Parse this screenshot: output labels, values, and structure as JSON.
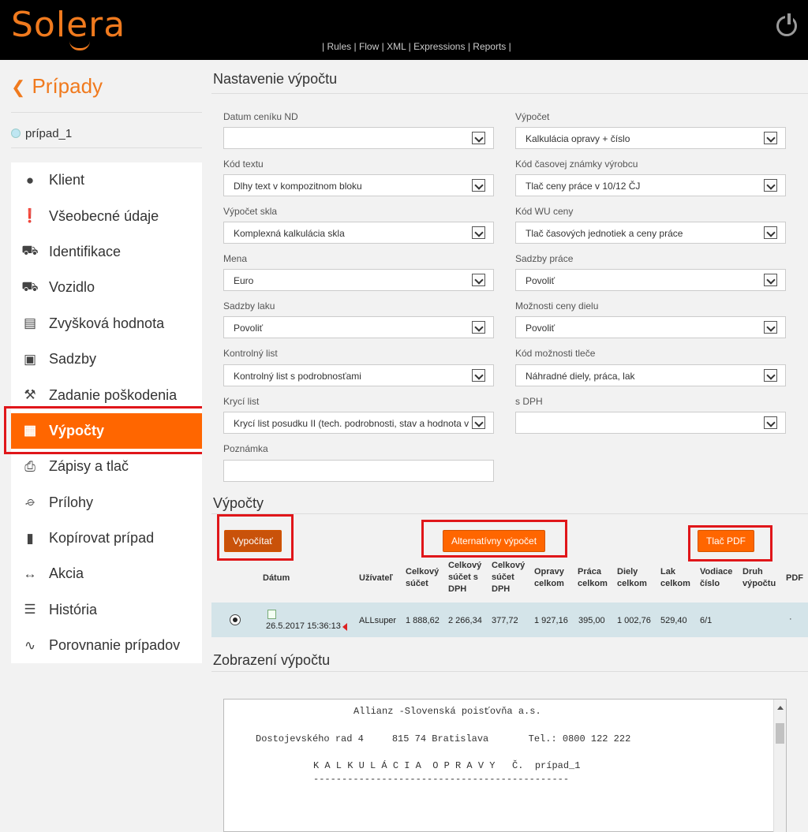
{
  "header": {
    "logo": "Solera",
    "nav": [
      "Rules",
      "Flow",
      "XML",
      "Expressions",
      "Reports"
    ]
  },
  "sidebar": {
    "back_label": "Prípady",
    "case_name": "prípad_1",
    "items": [
      {
        "label": "Klient",
        "icon": "user-icon"
      },
      {
        "label": "Všeobecné údaje",
        "icon": "exclamation-icon"
      },
      {
        "label": "Identifikace",
        "icon": "car-icon"
      },
      {
        "label": "Vozidlo",
        "icon": "taxi-icon"
      },
      {
        "label": "Zvyšková hodnota",
        "icon": "bar-chart-icon"
      },
      {
        "label": "Sadzby",
        "icon": "money-icon"
      },
      {
        "label": "Zadanie poškodenia",
        "icon": "wrench-icon"
      },
      {
        "label": "Výpočty",
        "icon": "calculator-icon",
        "active": true
      },
      {
        "label": "Zápisy a tlač",
        "icon": "printer-icon"
      },
      {
        "label": "Prílohy",
        "icon": "paperclip-icon"
      },
      {
        "label": "Kopírovat prípad",
        "icon": "book-icon"
      },
      {
        "label": "Akcia",
        "icon": "arrows-icon"
      },
      {
        "label": "História",
        "icon": "list-icon"
      },
      {
        "label": "Porovnanie prípadov",
        "icon": "line-chart-icon"
      }
    ]
  },
  "settings": {
    "title": "Nastavenie výpočtu",
    "left": [
      {
        "label": "Datum ceníku ND",
        "value": ""
      },
      {
        "label": "Kód textu",
        "value": "Dlhy text v kompozitnom bloku"
      },
      {
        "label": "Výpočet skla",
        "value": "Komplexná kalkulácia skla"
      },
      {
        "label": "Mena",
        "value": "Euro"
      },
      {
        "label": "Sadzby laku",
        "value": "Povoliť"
      },
      {
        "label": "Kontrolný list",
        "value": "Kontrolný list s podrobnosťami"
      },
      {
        "label": "Krycí list",
        "value": "Krycí list posudku II (tech. podrobnosti, stav a hodnota v"
      }
    ],
    "right": [
      {
        "label": "Výpočet",
        "value": "Kalkulácia opravy + číslo"
      },
      {
        "label": "Kód časovej známky výrobcu",
        "value": "Tlač ceny práce v 10/12 ČJ"
      },
      {
        "label": "Kód WU ceny",
        "value": "Tlač časových jednotiek a ceny práce"
      },
      {
        "label": "Sadzby práce",
        "value": "Povoliť"
      },
      {
        "label": "Možnosti ceny dielu",
        "value": "Povoliť"
      },
      {
        "label": "Kód možnosti tleče",
        "value": "Náhradné diely, práca, lak"
      },
      {
        "label": "s DPH",
        "value": ""
      }
    ],
    "note_label": "Poznámka"
  },
  "calculations": {
    "title": "Výpočty",
    "buttons": {
      "compute": "Vypočítať",
      "alternative": "Alternatívny výpočet",
      "print_pdf": "Tlač PDF"
    },
    "columns": [
      "Dátum",
      "Užívateľ",
      "Celkový súčet",
      "Celkový súčet s DPH",
      "Celkový súčet DPH",
      "Opravy celkom",
      "Práca celkom",
      "Diely celkom",
      "Lak celkom",
      "Vodiace číslo",
      "Druh výpočtu",
      "PDF"
    ],
    "row": {
      "date": "26.5.2017 15:36:13",
      "user": "ALLsuper",
      "total": "1 888,62",
      "total_vat": "2 266,34",
      "vat": "377,72",
      "repairs": "1 927,16",
      "labour": "395,00",
      "parts": "1 002,76",
      "paint": "529,40",
      "guide": "6/1",
      "type": "",
      "pdf": "·"
    }
  },
  "display": {
    "title": "Zobrazení výpočtu",
    "lines": [
      "Allianz -Slovenská poisťovňa a.s.",
      "Dostojevského rad 4     815 74 Bratislava       Tel.: 0800 122 222",
      "K A L K U L Á C I A  O P R A V Y   Č.  prípad_1",
      "---------------------------------------------"
    ]
  }
}
